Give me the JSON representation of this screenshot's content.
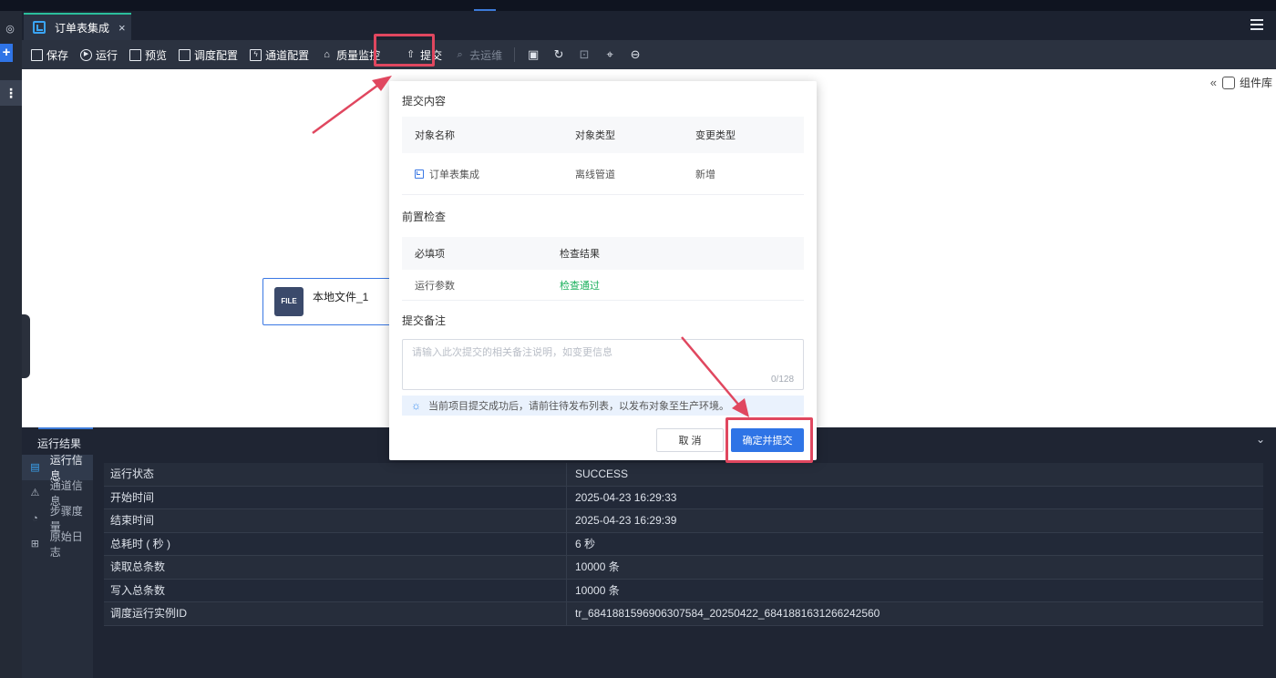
{
  "tab": {
    "label": "订单表集成",
    "close": "×"
  },
  "toolbar": {
    "save": "保存",
    "run": "运行",
    "preview": "预览",
    "schedule_config": "调度配置",
    "channel_config": "通道配置",
    "quality_monitor": "质量监控",
    "submit": "提交",
    "go_ops": "去运维"
  },
  "canvas": {
    "component_library": "组件库",
    "node_label": "本地文件_1",
    "node_icon_text": "FILE"
  },
  "modal": {
    "submit_content_title": "提交内容",
    "content_headers": [
      "对象名称",
      "对象类型",
      "变更类型"
    ],
    "content_row": {
      "name": "订单表集成",
      "type": "离线管道",
      "change": "新增"
    },
    "precheck_title": "前置检查",
    "check_headers": [
      "必填项",
      "检查结果"
    ],
    "check_row": {
      "item": "运行参数",
      "result": "检查通过"
    },
    "remark_title": "提交备注",
    "remark_placeholder": "请输入此次提交的相关备注说明，如变更信息",
    "remark_counter": "0/128",
    "tip": "当前项目提交成功后，请前往待发布列表，以发布对象至生产环境。",
    "cancel": "取 消",
    "confirm": "确定并提交"
  },
  "bottom": {
    "title": "运行结果",
    "side_items": [
      "运行信息",
      "通道信息",
      "步骤度量",
      "原始日志"
    ],
    "rows": [
      {
        "k": "运行状态",
        "v": "SUCCESS"
      },
      {
        "k": "开始时间",
        "v": "2025-04-23 16:29:33"
      },
      {
        "k": "结束时间",
        "v": "2025-04-23 16:29:39"
      },
      {
        "k": "总耗时 ( 秒 )",
        "v": "6 秒"
      },
      {
        "k": "读取总条数",
        "v": "10000 条"
      },
      {
        "k": "写入总条数",
        "v": "10000 条"
      },
      {
        "k": "调度运行实例ID",
        "v": "tr_6841881596906307584_20250422_6841881631266242560"
      }
    ]
  },
  "colors": {
    "accent": "#2f74e6",
    "highlight": "#e0475f",
    "success": "#1ab05c"
  }
}
